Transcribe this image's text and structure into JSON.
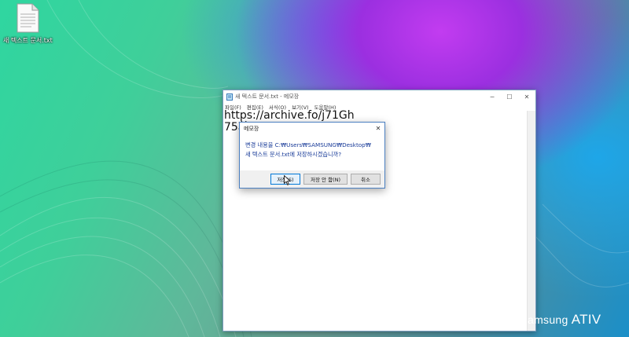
{
  "desktop": {
    "icon_label": "새 텍스트 문서.txt"
  },
  "notepad": {
    "title": "새 텍스트 문서.txt - 메모장",
    "menu": [
      "파일(F)",
      "편집(E)",
      "서식(O)",
      "보기(V)",
      "도움말(H)"
    ],
    "content_lines": [
      "https://archive.fo/j71Gh",
      "75화"
    ]
  },
  "dialog": {
    "title": "메모장",
    "message_line1": "변경 내용을 C:₩Users₩SAMSUNG₩Desktop₩",
    "message_line2": "새 텍스트 문서.txt에 저장하시겠습니까?",
    "buttons": {
      "save": "저장(S)",
      "dont_save": "저장 안 함(N)",
      "cancel": "취소"
    }
  },
  "branding": {
    "text_part1": "amsung",
    "text_part2": "ATIV"
  },
  "colors": {
    "dialog_message": "#1a3c99",
    "primary_button_border": "#0078d7"
  }
}
